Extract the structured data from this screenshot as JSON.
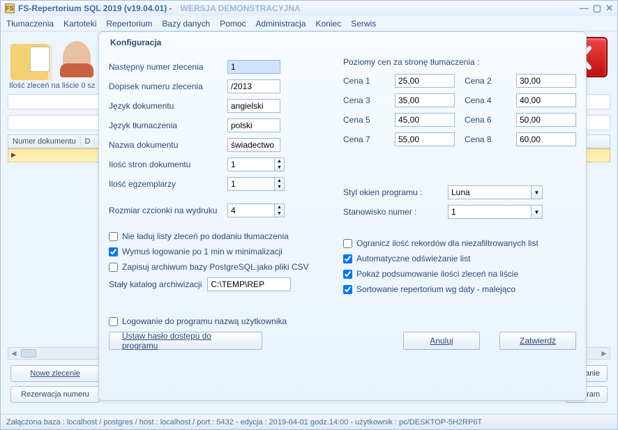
{
  "window": {
    "title": "FS-Repertorium SQL 2019  (v19.04.01)    -",
    "demo": "WERSJA DEMONSTRACYJNA"
  },
  "menu": {
    "tlumaczenia": "Tłumaczenia",
    "kartoteki": "Kartoteki",
    "repertorium": "Repertorium",
    "bazy": "Bazy danych",
    "pomoc": "Pomoc",
    "administracja": "Administracja",
    "koniec": "Koniec",
    "serwis": "Serwis"
  },
  "background": {
    "count_caption": "Ilość zleceń na liście 0 sz",
    "col_numer_dokumentu": "Numer dokumentu",
    "col_d": "D",
    "btn_nowe": "Nowe zlecenie",
    "btn_rezerwacja": "Rezerwacja numeru",
    "btn_wanie": "wanie",
    "btn_rogram": "rogram"
  },
  "modal": {
    "title": "Konfiguracja",
    "labels": {
      "nastepny": "Następny numer zlecenia",
      "dopisek": "Dopisek numeru zlecenia",
      "jezyk_dok": "Język dokumentu",
      "jezyk_tlum": "Język tłumaczenia",
      "nazwa_dok": "Nazwa dokumentu",
      "ilosc_stron": "Ilość stron dokumentu",
      "ilosc_egz": "Ilość egzemplarzy",
      "rozmiar_czcionki": "Rozmiar czcionki na wydruku",
      "poziomy": "Poziomy cen za stronę tłumaczenia :",
      "styl_okien": "Styl okien programu :",
      "stanowisko": "Stanowisko numer :",
      "cena1": "Cena 1",
      "cena2": "Cena 2",
      "cena3": "Cena 3",
      "cena4": "Cena 4",
      "cena5": "Cena 5",
      "cena6": "Cena 6",
      "cena7": "Cena 7",
      "cena8": "Cena 8",
      "staly_katalog": "Stały katalog archiwizacji"
    },
    "values": {
      "nastepny": "1",
      "dopisek": "/2013",
      "jezyk_dok": "angielski",
      "jezyk_tlum": "polski",
      "nazwa_dok": "świadectwo",
      "ilosc_stron": "1",
      "ilosc_egz": "1",
      "rozmiar_czcionki": "4",
      "cena1": "25,00",
      "cena2": "30,00",
      "cena3": "35,00",
      "cena4": "40,00",
      "cena5": "45,00",
      "cena6": "50,00",
      "cena7": "55,00",
      "cena8": "60,00",
      "styl_okien": "Luna",
      "stanowisko": "1",
      "staly_katalog": "C:\\TEMP\\REP"
    },
    "checks": {
      "nie_laduj": "Nie ładuj listy zleceń po dodaniu tłumaczenia",
      "wymus": "Wymuś logowanie po 1 min w minimalizacji",
      "zapisuj": "Zapisuj archiwum bazy PostgreSQL jako pliki CSV",
      "ogranicz": "Ogranicz ilość rekordów dla niezafiltrowanych list",
      "auto": "Automatyczne odświeżanie list",
      "pokaz": "Pokaż podsumowanie ilości zleceń na liście",
      "sort": "Sortowanie repertorium wg daty - malejąco",
      "logowanie_user": "Logowanie do programu nazwą użytkownika"
    },
    "buttons": {
      "ustaw_haslo": "Ustaw hasło dostępu do programu",
      "anuluj": "Anuluj",
      "zatwierdz": "Zatwierdź"
    }
  },
  "status": "Załączona baza : localhost  /  postgres  /  host : localhost  /  port : 5432  -    edycja : 2019-04-01  godz.14:00    -   użytkownik : pc/DESKTOP-5H2RP6T"
}
